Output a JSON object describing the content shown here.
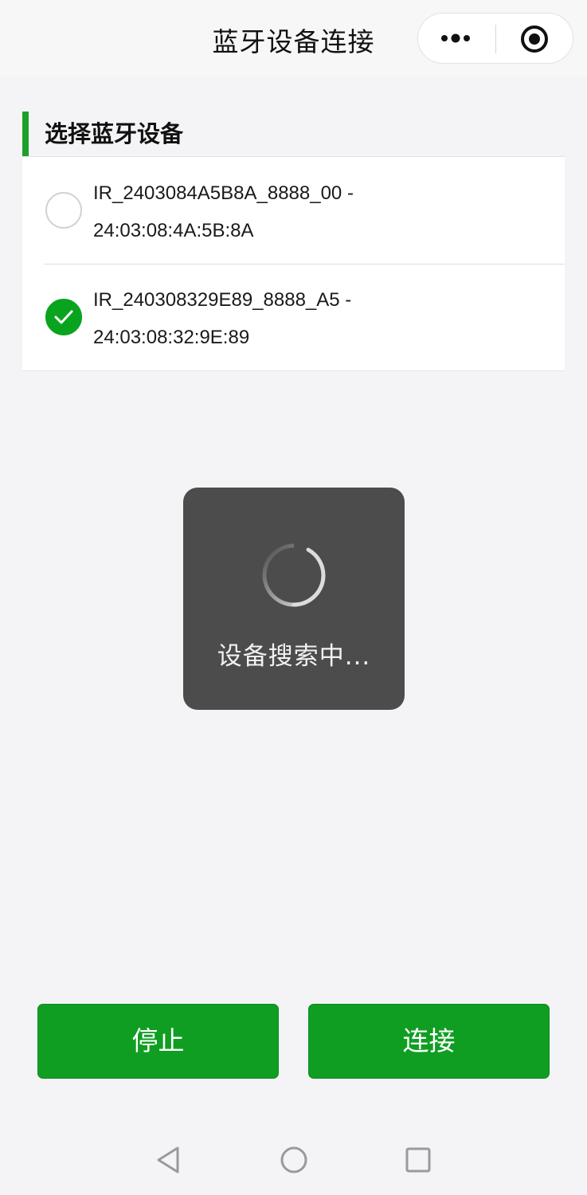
{
  "header": {
    "title": "蓝牙设备连接",
    "more_icon": "more-dots-icon",
    "close_icon": "target-circle-icon"
  },
  "section": {
    "title": "选择蓝牙设备",
    "accent_color": "#1ba12b"
  },
  "devices": [
    {
      "name_line": "IR_2403084A5B8A_8888_00 -",
      "mac_line": "24:03:08:4A:5B:8A",
      "selected": false
    },
    {
      "name_line": "IR_240308329E89_8888_A5 -",
      "mac_line": "24:03:08:32:9E:89",
      "selected": true
    }
  ],
  "loading": {
    "text": "设备搜索中..."
  },
  "buttons": {
    "stop_label": "停止",
    "connect_label": "连接",
    "color": "#109e22"
  },
  "navbar": {
    "back_icon": "back-triangle-icon",
    "home_icon": "home-circle-icon",
    "recent_icon": "recent-square-icon"
  }
}
